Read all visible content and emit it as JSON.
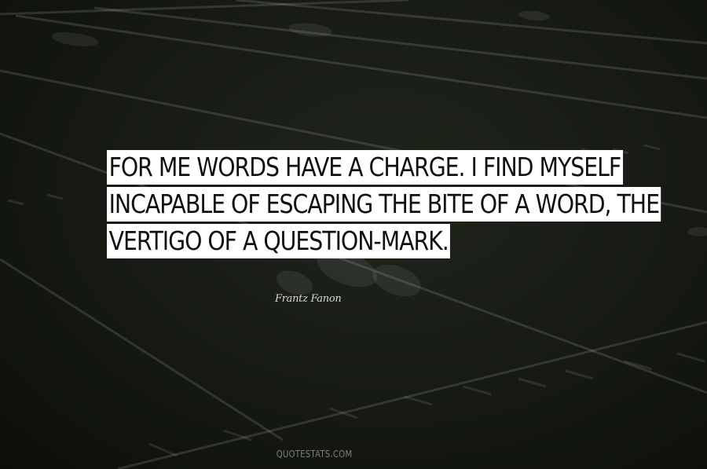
{
  "quote": {
    "lines": [
      "FOR ME WORDS HAVE A CHARGE. I FIND MYSELF",
      "INCAPABLE OF ESCAPING THE BITE OF A WORD, THE",
      "VERTIGO OF A QUESTION-MARK."
    ]
  },
  "author": "Frantz Fanon",
  "watermark": "QUOTESTATS.COM",
  "colors": {
    "background": "#161a13",
    "field_lines": "#ffffff",
    "highlight": "#ffffff",
    "quote_text": "#111111",
    "author_text": "#d8d8d8"
  }
}
